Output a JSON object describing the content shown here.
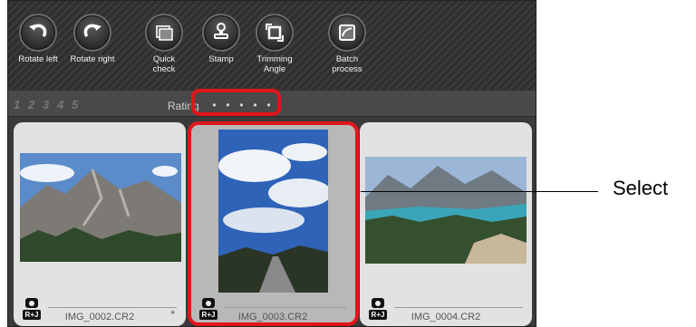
{
  "toolbar": {
    "buttons": [
      {
        "label": "Rotate left",
        "icon": "rotate-left-icon"
      },
      {
        "label": "Rotate right",
        "icon": "rotate-right-icon"
      },
      {
        "label": "Quick\ncheck",
        "icon": "quick-check-icon"
      },
      {
        "label": "Stamp",
        "icon": "stamp-icon"
      },
      {
        "label": "Trimming\nAngle",
        "icon": "trimming-angle-icon"
      },
      {
        "label": "Batch\nprocess",
        "icon": "batch-process-icon"
      }
    ]
  },
  "rating_bar": {
    "stars": [
      "1",
      "2",
      "3",
      "4",
      "5"
    ],
    "label": "Rating",
    "dots": [
      "•",
      "•",
      "•",
      "•",
      "•"
    ]
  },
  "thumbnails": [
    {
      "filename": "IMG_0002.CR2",
      "tag": "R+J",
      "edited_mark": "*",
      "selected": false
    },
    {
      "filename": "IMG_0003.CR2",
      "tag": "R+J",
      "edited_mark": "",
      "selected": true
    },
    {
      "filename": "IMG_0004.CR2",
      "tag": "R+J",
      "edited_mark": "",
      "selected": false
    }
  ],
  "annotation": {
    "select_label": "Select"
  },
  "colors": {
    "highlight": "#e0161c",
    "toolbar_bg": "#3a3a3a",
    "card_bg": "#e2e2e2",
    "card_selected_bg": "#b8b8b8"
  }
}
